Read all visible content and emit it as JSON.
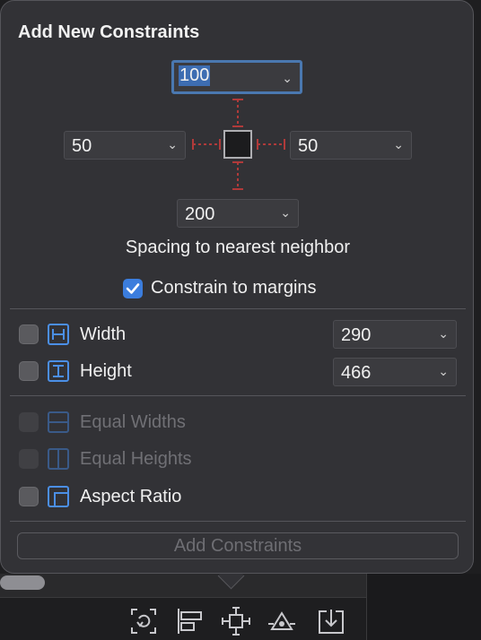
{
  "popover": {
    "title": "Add New Constraints",
    "spacing": {
      "top": "100",
      "left": "50",
      "right": "50",
      "bottom": "200"
    },
    "spacing_caption": "Spacing to nearest neighbor",
    "constrain_to_margins": {
      "label": "Constrain to margins",
      "checked": true
    },
    "size_rows": [
      {
        "label": "Width",
        "value": "290",
        "checked": false
      },
      {
        "label": "Height",
        "value": "466",
        "checked": false
      }
    ],
    "equal_rows": [
      {
        "label": "Equal Widths",
        "enabled": false
      },
      {
        "label": "Equal Heights",
        "enabled": false
      },
      {
        "label": "Aspect Ratio",
        "enabled": true
      }
    ],
    "add_button": "Add Constraints"
  },
  "toolbar": {
    "icons": [
      "update-frames-icon",
      "align-icon",
      "add-constraints-icon",
      "resolve-issues-icon",
      "embed-in-icon"
    ]
  },
  "colors": {
    "accent": "#3b7ddd",
    "strut": "#b03a3a",
    "popover_bg": "#323236"
  }
}
